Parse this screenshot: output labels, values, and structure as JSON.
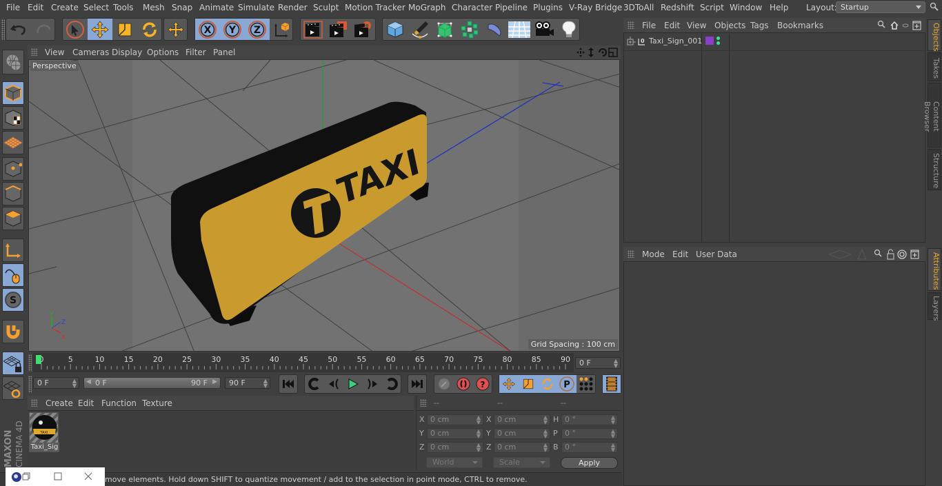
{
  "menubar": {
    "items": [
      "File",
      "Edit",
      "Create",
      "Select",
      "Tools",
      "Mesh",
      "Snap",
      "Animate",
      "Simulate",
      "Render",
      "Sculpt",
      "Motion Tracker",
      "MoGraph",
      "Character",
      "Pipeline",
      "Plugins",
      "V-Ray Bridge",
      "3DToAll",
      "Redshift",
      "Script",
      "Window",
      "Help"
    ],
    "layout_label": "Layout:",
    "layout_value": "Startup"
  },
  "toolbar": {
    "icons": [
      "undo-icon",
      "redo-icon",
      "live-selection-icon",
      "move-icon",
      "scale-icon",
      "rotate-icon",
      "recent-tool-icon",
      "x-axis-lock-icon",
      "y-axis-lock-icon",
      "z-axis-lock-icon",
      "coordinate-system-icon",
      "render-view-icon",
      "render-picture-viewer-icon",
      "render-settings-icon",
      "cube-primitive-icon",
      "pen-spline-icon",
      "subdivision-generator-icon",
      "cloner-icon",
      "deformer-bend-icon",
      "floor-environment-icon",
      "camera-icon",
      "light-icon"
    ]
  },
  "viewport": {
    "menu": [
      "View",
      "Cameras",
      "Display",
      "Options",
      "Filter",
      "Panel"
    ],
    "camera_label": "Perspective",
    "grid_spacing": "Grid Spacing : 100 cm",
    "object_text": "TAXI"
  },
  "left_tools": [
    "make-editable-icon",
    "model-mode-icon",
    "texture-mode-icon",
    "workplane-mode-icon",
    "points-mode-icon",
    "edges-mode-icon",
    "polygons-mode-icon",
    "axis-mode-icon",
    "tweak-mode-icon",
    "solo-mode-icon",
    "snap-magnet-icon",
    "workplane-lock-icon",
    "workplane-align-icon"
  ],
  "timeline": {
    "ticks": [
      "0",
      "5",
      "10",
      "15",
      "20",
      "25",
      "30",
      "35",
      "40",
      "45",
      "50",
      "55",
      "60",
      "65",
      "70",
      "75",
      "80",
      "85",
      "90"
    ],
    "current_frame": "0 F",
    "start_frame": "0 F",
    "range_start": "0 F",
    "range_end": "90 F",
    "end_frame": "90 F",
    "playhead_frame": 0,
    "max_frame": 90
  },
  "playback": {
    "buttons": [
      "go-to-start",
      "previous-key",
      "previous-frame",
      "play-forward",
      "next-frame",
      "next-key",
      "go-to-end",
      "record-keys",
      "autokeying",
      "keyframe-selection",
      "key-position",
      "key-scale",
      "key-rotation",
      "key-parameter",
      "key-point-level",
      "timeline-window"
    ]
  },
  "materials": {
    "menu": [
      "Create",
      "Edit",
      "Function",
      "Texture"
    ],
    "items": [
      {
        "name": "Taxi_Sig"
      }
    ]
  },
  "coordinates": {
    "headers": [
      "--",
      "--",
      "--"
    ],
    "rows": [
      {
        "a_label": "X",
        "a_value": "0 cm",
        "b_label": "X",
        "b_value": "0 cm",
        "c_label": "H",
        "c_value": "0 °"
      },
      {
        "a_label": "Y",
        "a_value": "0 cm",
        "b_label": "Y",
        "b_value": "0 cm",
        "c_label": "P",
        "c_value": "0 °"
      },
      {
        "a_label": "Z",
        "a_value": "0 cm",
        "b_label": "Z",
        "b_value": "0 cm",
        "c_label": "B",
        "c_value": "0 °"
      }
    ],
    "space_dropdown": "World",
    "mode_dropdown": "Scale",
    "apply_label": "Apply"
  },
  "objects_panel": {
    "menu": [
      "File",
      "Edit",
      "View",
      "Objects",
      "Tags",
      "Bookmarks"
    ],
    "objects": [
      {
        "name": "Taxi_Sign_001",
        "layer_color": "#8a3fc8"
      }
    ]
  },
  "attributes_panel": {
    "menu": [
      "Mode",
      "Edit",
      "User Data"
    ]
  },
  "side_tabs_top": [
    {
      "label": "Objects",
      "active": true
    },
    {
      "label": "Takes",
      "active": false
    },
    {
      "label": "Content Browser",
      "active": false
    },
    {
      "label": "Structure",
      "active": false
    }
  ],
  "side_tabs_bottom": [
    {
      "label": "Attributes",
      "active": true
    },
    {
      "label": "Layers",
      "active": false
    }
  ],
  "status_text": "move elements. Hold down SHIFT to quantize movement / add to the selection in point mode, CTRL to remove.",
  "brand": {
    "line1": "MAXON",
    "line2": "CINEMA 4D"
  },
  "colors": {
    "accent": "#8aa8d6",
    "orange": "#f0a020",
    "taxi_yellow": "#c99a2e",
    "tab_active": "#e8a72a"
  }
}
